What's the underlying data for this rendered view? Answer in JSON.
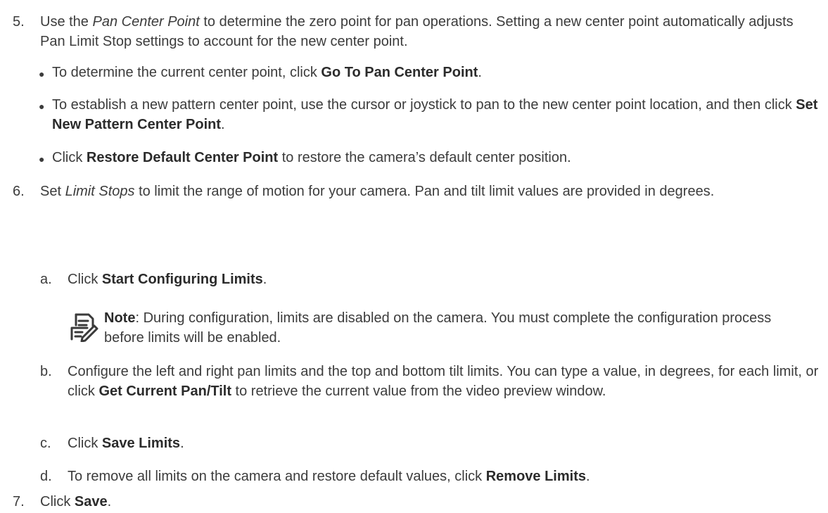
{
  "step5": {
    "num": "5.",
    "pre": "Use the ",
    "em": "Pan Center Point",
    "post": " to determine the zero point for pan operations. Setting a new center point automatically adjusts Pan Limit Stop settings to account for the new center point.",
    "bullets": [
      {
        "pre": "To determine the current center point, click ",
        "bold": "Go To Pan Center Point",
        "post": "."
      },
      {
        "pre": "To establish a new pattern center point, use the cursor or joystick to pan to the new center point location, and then click ",
        "bold": "Set New Pattern Center Point",
        "post": "."
      },
      {
        "pre": "Click ",
        "bold": "Restore Default Center Point",
        "post": " to restore the camera’s default center position."
      }
    ]
  },
  "step6": {
    "num": "6.",
    "pre": "Set ",
    "em": "Limit Stops",
    "post": " to limit the range of motion for your camera. Pan and tilt limit values are provided in degrees.",
    "sub": [
      {
        "letter": "a.",
        "pre": "Click ",
        "bold": "Start Configuring Limits",
        "post": "."
      },
      {
        "letter": "b.",
        "pre": "Configure the left and right pan limits and the top and bottom tilt limits. You can type a value, in degrees, for each limit, or click ",
        "bold": "Get Current Pan/Tilt",
        "post": " to retrieve the current value from the video preview window."
      },
      {
        "letter": "c.",
        "pre": "Click ",
        "bold": "Save Limits",
        "post": "."
      },
      {
        "letter": "d.",
        "pre": "To remove all limits on the camera and restore default values, click ",
        "bold": "Remove Limits",
        "post": "."
      }
    ],
    "note": {
      "label": "Note",
      "text": ": During configuration, limits are disabled on the camera. You must complete the configuration process before limits will be enabled.",
      "icon": "note-icon"
    }
  },
  "step7": {
    "num": "7.",
    "pre": "Click ",
    "bold": "Save",
    "post": "."
  }
}
